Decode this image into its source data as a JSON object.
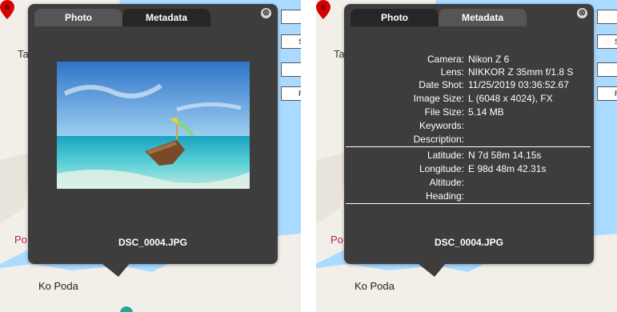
{
  "tabs": {
    "photo": "Photo",
    "metadata": "Metadata"
  },
  "close_symbol": "⊗",
  "map": {
    "label_ta": "Ta",
    "label_po": "Po",
    "label_ko_poda": "Ko Poda",
    "side_button_letters": [
      "",
      "S",
      "",
      "R"
    ],
    "colors": {
      "land": "#f2efe9",
      "water": "#aadaff",
      "pin": "#d50000"
    }
  },
  "left_popup": {
    "active_tab": "photo",
    "filename": "DSC_0004.JPG",
    "photo_icon": "boat-photo"
  },
  "right_popup": {
    "active_tab": "metadata",
    "filename": "DSC_0004.JPG",
    "camera_fields": [
      {
        "key": "Camera:",
        "value": "Nikon Z 6"
      },
      {
        "key": "Lens:",
        "value": "NIKKOR Z 35mm f/1.8 S"
      },
      {
        "key": "Date Shot:",
        "value": "11/25/2019 03:36:52.67"
      },
      {
        "key": "Image Size:",
        "value": "L (6048 x 4024), FX"
      },
      {
        "key": "File Size:",
        "value": "5.14 MB"
      },
      {
        "key": "Keywords:",
        "value": ""
      },
      {
        "key": "Description:",
        "value": ""
      }
    ],
    "geo_fields": [
      {
        "key": "Latitude:",
        "value": "N 7d 58m 14.15s"
      },
      {
        "key": "Longitude:",
        "value": "E 98d 48m 42.31s"
      },
      {
        "key": "Altitude:",
        "value": ""
      },
      {
        "key": "Heading:",
        "value": ""
      }
    ]
  }
}
